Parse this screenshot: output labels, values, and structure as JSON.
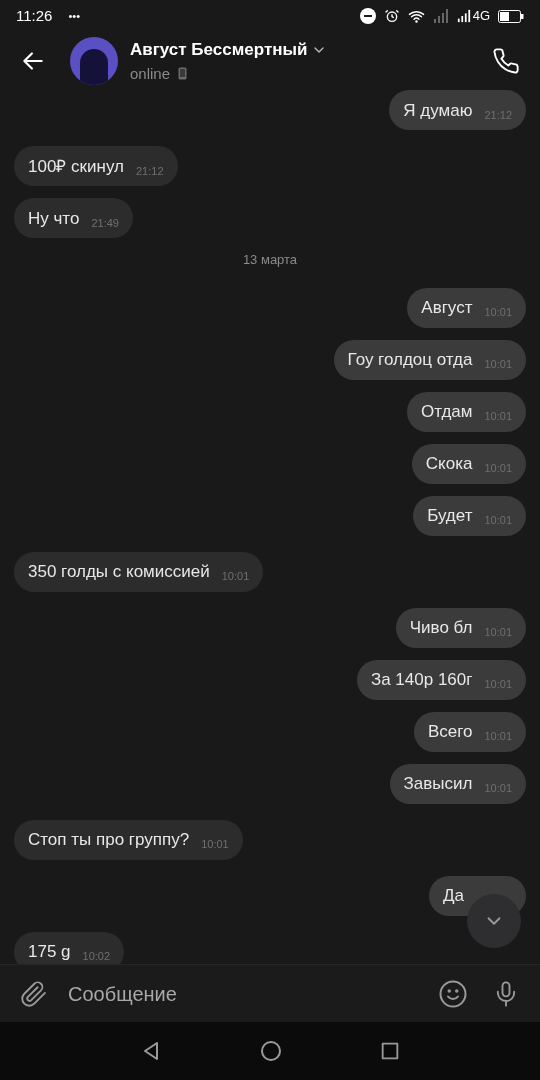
{
  "status_bar": {
    "time": "11:26",
    "more": "•••",
    "network": "4G"
  },
  "header": {
    "name": "Август Бессмертный",
    "status": "online"
  },
  "messages": [
    {
      "kind": "out",
      "text": "Я думаю",
      "time": "21:12"
    },
    {
      "kind": "in",
      "text": "100₽ скинул",
      "time": "21:12"
    },
    {
      "kind": "in",
      "text": "Ну что",
      "time": "21:49"
    },
    {
      "kind": "date",
      "text": "13 марта"
    },
    {
      "kind": "out",
      "text": "Август",
      "time": "10:01"
    },
    {
      "kind": "out",
      "text": "Гоу голдоц отда",
      "time": "10:01"
    },
    {
      "kind": "out",
      "text": "Отдам",
      "time": "10:01"
    },
    {
      "kind": "out",
      "text": "Скока",
      "time": "10:01"
    },
    {
      "kind": "out",
      "text": "Будет",
      "time": "10:01"
    },
    {
      "kind": "in",
      "text": "350 голды с комиссией",
      "time": "10:01"
    },
    {
      "kind": "out",
      "text": "Чиво бл",
      "time": "10:01"
    },
    {
      "kind": "out",
      "text": "За 140р 160г",
      "time": "10:01"
    },
    {
      "kind": "out",
      "text": "Всего",
      "time": "10:01"
    },
    {
      "kind": "out",
      "text": "Завысил",
      "time": "10:01"
    },
    {
      "kind": "in",
      "text": "Стоп ты про группу?",
      "time": "10:01"
    },
    {
      "kind": "out",
      "text": "Да"
    },
    {
      "kind": "in",
      "text": "175 g",
      "time": "10:02"
    }
  ],
  "composer": {
    "placeholder": "Сообщение"
  }
}
